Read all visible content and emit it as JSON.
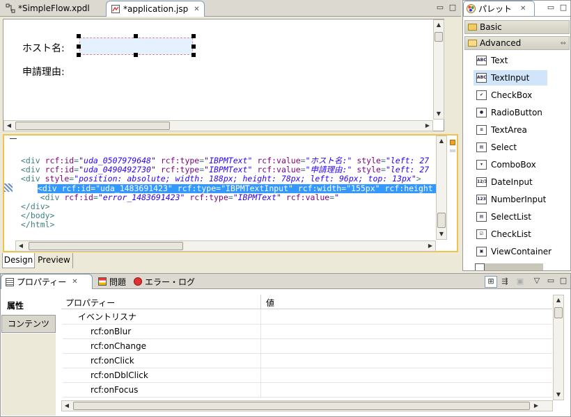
{
  "editor": {
    "tabs": [
      {
        "label": "*SimpleFlow.xpdl",
        "icon": "xpdl-flow-icon"
      },
      {
        "label": "*application.jsp",
        "icon": "jsp-file-icon"
      }
    ],
    "design": {
      "host_label": "ホスト名:",
      "reason_label": "申請理由:"
    },
    "code_lines": [
      {
        "indent": "",
        "parts": [
          [
            "t",
            "<div "
          ],
          [
            "a",
            "rcf:id"
          ],
          [
            "t",
            "="
          ],
          [
            "v",
            "\"uda_0507979648\""
          ],
          [
            "t",
            " "
          ],
          [
            "a",
            "rcf:type"
          ],
          [
            "t",
            "="
          ],
          [
            "v",
            "\"IBPMText\""
          ],
          [
            "t",
            " "
          ],
          [
            "a",
            "rcf:value"
          ],
          [
            "t",
            "="
          ],
          [
            "v",
            "\"ホスト名:\""
          ],
          [
            "t",
            " "
          ],
          [
            "a",
            "style"
          ],
          [
            "t",
            "="
          ],
          [
            "v",
            "\"left: 27"
          ]
        ]
      },
      {
        "indent": "",
        "parts": [
          [
            "t",
            "<div "
          ],
          [
            "a",
            "rcf:id"
          ],
          [
            "t",
            "="
          ],
          [
            "v",
            "\"uda_0490492730\""
          ],
          [
            "t",
            " "
          ],
          [
            "a",
            "rcf:type"
          ],
          [
            "t",
            "="
          ],
          [
            "v",
            "\"IBPMText\""
          ],
          [
            "t",
            " "
          ],
          [
            "a",
            "rcf:value"
          ],
          [
            "t",
            "="
          ],
          [
            "v",
            "\"申請理由:\""
          ],
          [
            "t",
            " "
          ],
          [
            "a",
            "style"
          ],
          [
            "t",
            "="
          ],
          [
            "v",
            "\"left: 27"
          ]
        ]
      },
      {
        "indent": "",
        "parts": [
          [
            "t",
            "<div "
          ],
          [
            "a",
            "style"
          ],
          [
            "t",
            "="
          ],
          [
            "v",
            "\"position: absolute; width: 188px; height: 78px; left: 96px; top: 13px\""
          ],
          [
            "t",
            ">"
          ]
        ]
      },
      {
        "indent": "    ",
        "selected": true,
        "parts": [
          [
            "t",
            "<div rcf:id=\"uda_1483691423\" rcf:type=\"IBPMTextInput\" rcf:width=\"155px\" rcf:height"
          ]
        ]
      },
      {
        "indent": "    ",
        "parts": [
          [
            "t",
            "<div "
          ],
          [
            "a",
            "rcf:id"
          ],
          [
            "t",
            "="
          ],
          [
            "v",
            "\"error_1483691423\""
          ],
          [
            "t",
            " "
          ],
          [
            "a",
            "rcf:type"
          ],
          [
            "t",
            "="
          ],
          [
            "v",
            "\"IBPMText\""
          ],
          [
            "t",
            " "
          ],
          [
            "a",
            "rcf:value"
          ],
          [
            "t",
            "="
          ],
          [
            "v",
            "\""
          ]
        ]
      },
      {
        "indent": "",
        "parts": [
          [
            "t",
            "</div>"
          ]
        ]
      },
      {
        "indent": "",
        "parts": [
          [
            "t",
            "</body>"
          ]
        ]
      },
      {
        "indent": "",
        "parts": [
          [
            "t",
            "</html>"
          ]
        ]
      }
    ],
    "mode_tabs": [
      "Design",
      "Preview"
    ]
  },
  "palette": {
    "title": "パレット",
    "groups": [
      "Basic",
      "Advanced"
    ],
    "items": [
      {
        "label": "Text",
        "icon": "text-icon",
        "glyph": "ABC"
      },
      {
        "label": "TextInput",
        "icon": "textinput-icon",
        "glyph": "ABC",
        "selected": true
      },
      {
        "label": "CheckBox",
        "icon": "checkbox-icon",
        "glyph": "✔"
      },
      {
        "label": "RadioButton",
        "icon": "radiobutton-icon",
        "glyph": "●"
      },
      {
        "label": "TextArea",
        "icon": "textarea-icon",
        "glyph": "≡"
      },
      {
        "label": "Select",
        "icon": "select-icon",
        "glyph": "▤"
      },
      {
        "label": "ComboBox",
        "icon": "combobox-icon",
        "glyph": "▾"
      },
      {
        "label": "DateInput",
        "icon": "dateinput-icon",
        "glyph": "12/3"
      },
      {
        "label": "NumberInput",
        "icon": "numberinput-icon",
        "glyph": "123"
      },
      {
        "label": "SelectList",
        "icon": "selectlist-icon",
        "glyph": "▤"
      },
      {
        "label": "CheckList",
        "icon": "checklist-icon",
        "glyph": "☑"
      },
      {
        "label": "ViewContainer",
        "icon": "viewcontainer-icon",
        "glyph": "▣"
      }
    ]
  },
  "bottom": {
    "tabs": [
      {
        "label": "プロパティー",
        "icon": "properties-icon"
      },
      {
        "label": "問題",
        "icon": "problems-icon"
      },
      {
        "label": "エラー・ログ",
        "icon": "error-log-icon"
      }
    ],
    "side_tabs": [
      "属性",
      "コンテンツ"
    ],
    "columns": [
      "プロパティー",
      "値"
    ],
    "rows": [
      {
        "name": "イベントリスナ",
        "value": "",
        "group": true
      },
      {
        "name": "rcf:onBlur",
        "value": ""
      },
      {
        "name": "rcf:onChange",
        "value": ""
      },
      {
        "name": "rcf:onClick",
        "value": ""
      },
      {
        "name": "rcf:onDblClick",
        "value": ""
      },
      {
        "name": "rcf:onFocus",
        "value": ""
      }
    ]
  }
}
